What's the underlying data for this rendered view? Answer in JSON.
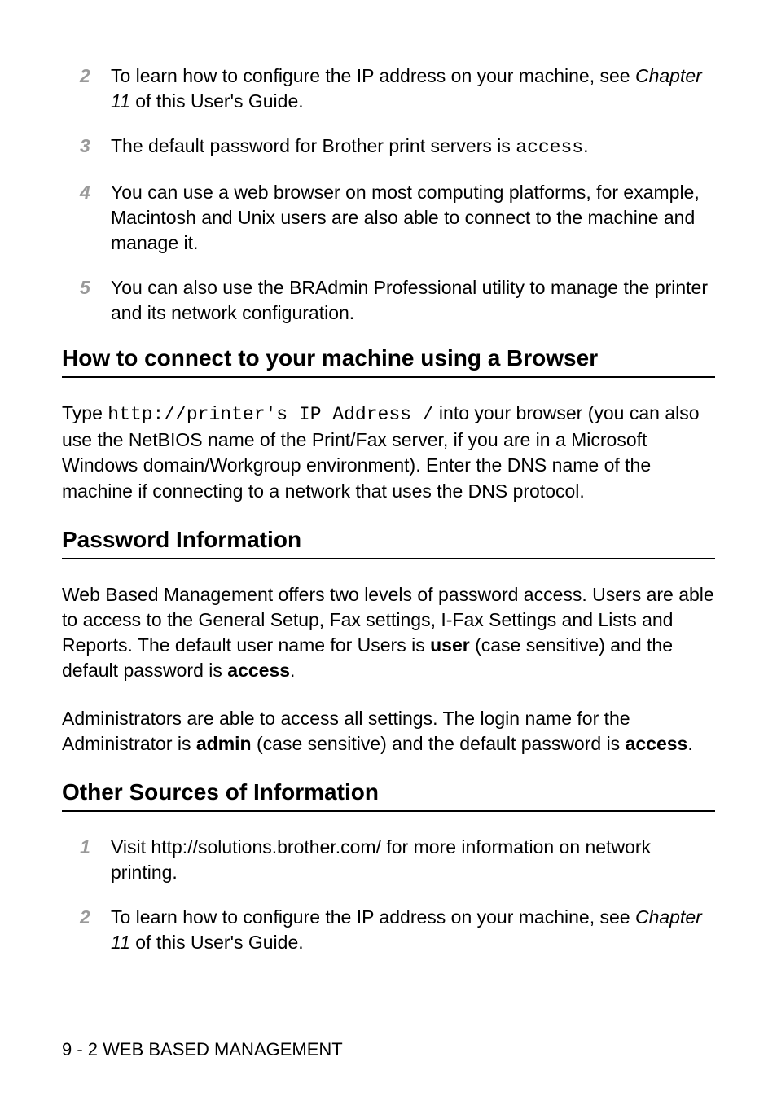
{
  "list1": {
    "item2": {
      "num": "2",
      "pre": "To learn how to configure the IP address on your machine, see ",
      "chapter": "Chapter 11",
      "post": " of this User's Guide."
    },
    "item3": {
      "num": "3",
      "pre": "The default password for Brother print servers is ",
      "code": "access",
      "post": "."
    },
    "item4": {
      "num": "4",
      "text": "You can use a web browser on most computing platforms, for example, Macintosh and Unix users are also able to connect to the machine and manage it."
    },
    "item5": {
      "num": "5",
      "text": "You can also use the BRAdmin Professional utility to manage the printer and its network configuration."
    }
  },
  "section1": {
    "heading": "How to connect to your machine using a Browser",
    "para_pre": "Type ",
    "para_code": "http://printer's IP Address /",
    "para_post": " into your browser (you can also use the NetBIOS name of the Print/Fax server, if you are in a Microsoft Windows domain/Workgroup environment). Enter the DNS name of the machine if connecting to a network that uses the DNS protocol."
  },
  "section2": {
    "heading": "Password Information",
    "para1_pre": "Web Based Management offers two levels of password access. Users are able to access to the General Setup, Fax settings, I-Fax Settings and Lists and Reports. The default user name for Users is ",
    "user_bold": "user",
    "para1_mid": " (case sensitive) and the default password is ",
    "access_bold": "access",
    "para1_post": ".",
    "para2_pre": "Administrators are able to access all settings. The login name for the Administrator is ",
    "admin_bold": "admin",
    "para2_mid": " (case sensitive) and the default password is ",
    "access2_bold": "access",
    "para2_post": "."
  },
  "section3": {
    "heading": "Other Sources of Information",
    "item1": {
      "num": "1",
      "text": "Visit http://solutions.brother.com/ for more information on network printing."
    },
    "item2": {
      "num": "2",
      "pre": "To learn how to configure the IP address on your machine, see ",
      "chapter": "Chapter 11",
      "post": " of this User's Guide."
    }
  },
  "footer": "9 - 2 WEB BASED MANAGEMENT"
}
